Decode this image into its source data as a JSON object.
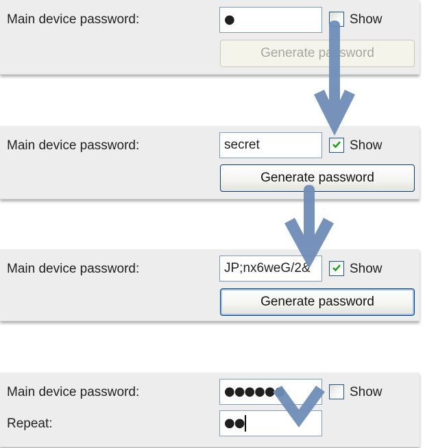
{
  "colors": {
    "panel_bg": "#ededed",
    "input_border": "#7f9db9",
    "button_border": "#003c74",
    "checkmark": "#21a121",
    "arrow": "#6f8db8"
  },
  "step1": {
    "label": "Main device password:",
    "password_masked": "●",
    "show_checked": false,
    "show_label": "Show",
    "button_label": "Generate password",
    "button_enabled": false
  },
  "step2": {
    "label": "Main device password:",
    "password_value": "secret",
    "show_checked": true,
    "show_label": "Show",
    "button_label": "Generate password",
    "button_enabled": true
  },
  "step3": {
    "label": "Main device password:",
    "password_value": "JP;nx6weG/2&",
    "show_checked": true,
    "show_label": "Show",
    "button_label": "Generate password",
    "button_enabled": true
  },
  "step4": {
    "label": "Main device password:",
    "password_masked": "●●●●●●",
    "show_checked": false,
    "show_label": "Show",
    "repeat_label": "Repeat:",
    "repeat_masked": "●●"
  }
}
